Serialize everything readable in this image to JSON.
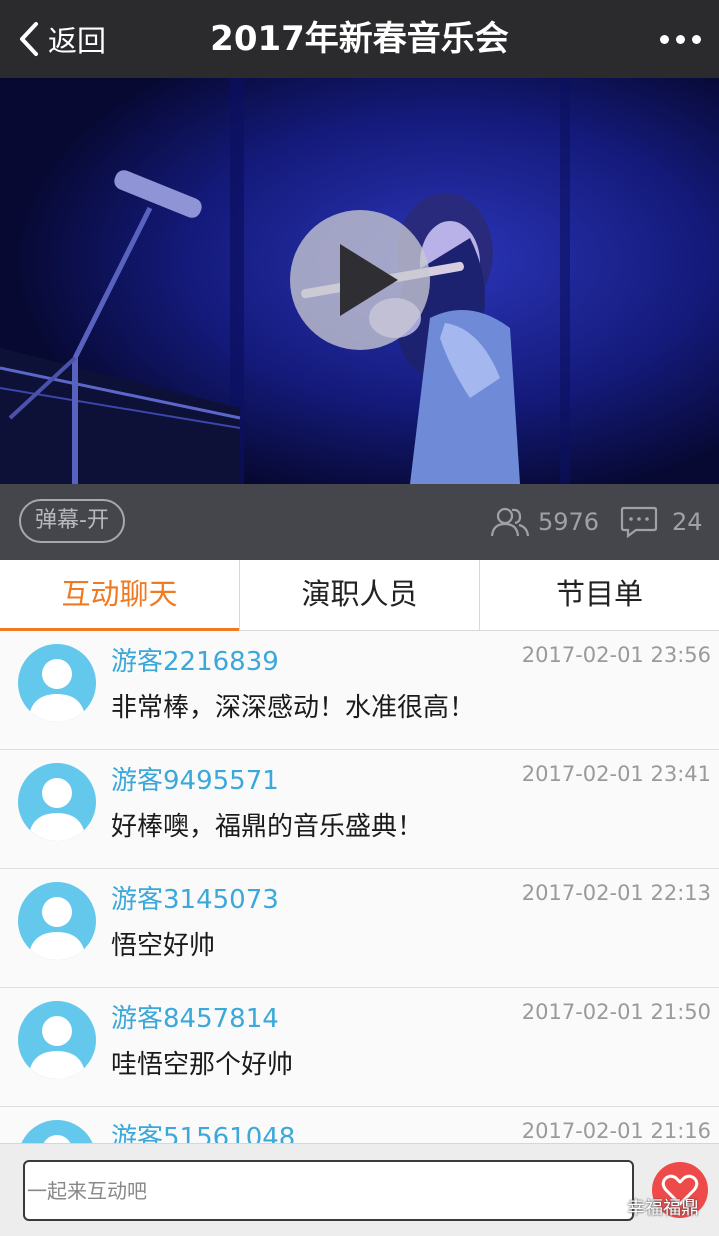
{
  "nav": {
    "back_label": "返回",
    "title": "2017年新春音乐会",
    "more_icon": "more-dots-icon"
  },
  "video": {
    "play_icon": "play-icon"
  },
  "infobar": {
    "danmaku_label": "弹幕-开",
    "viewer_count": "5976",
    "comment_count": "24"
  },
  "tabs": [
    {
      "label": "互动聊天",
      "active": true
    },
    {
      "label": "演职人员",
      "active": false
    },
    {
      "label": "节目单",
      "active": false
    }
  ],
  "messages": [
    {
      "user": "游客2216839",
      "time": "2017-02-01 23:56",
      "text": "非常棒，深深感动！水准很高！"
    },
    {
      "user": "游客9495571",
      "time": "2017-02-01 23:41",
      "text": "好棒噢，福鼎的音乐盛典！"
    },
    {
      "user": "游客3145073",
      "time": "2017-02-01 22:13",
      "text": "悟空好帅"
    },
    {
      "user": "游客8457814",
      "time": "2017-02-01 21:50",
      "text": "哇悟空那个好帅"
    },
    {
      "user": "游客51561048",
      "time": "2017-02-01 21:16",
      "text": ""
    }
  ],
  "input": {
    "placeholder": "一起来互动吧"
  },
  "watermark": "幸福福鼎",
  "colors": {
    "accent": "#f07a21",
    "username": "#3ba8d9",
    "avatar": "#63c8ec",
    "heart": "#ee4a49",
    "navbar": "#2b2b2d"
  }
}
